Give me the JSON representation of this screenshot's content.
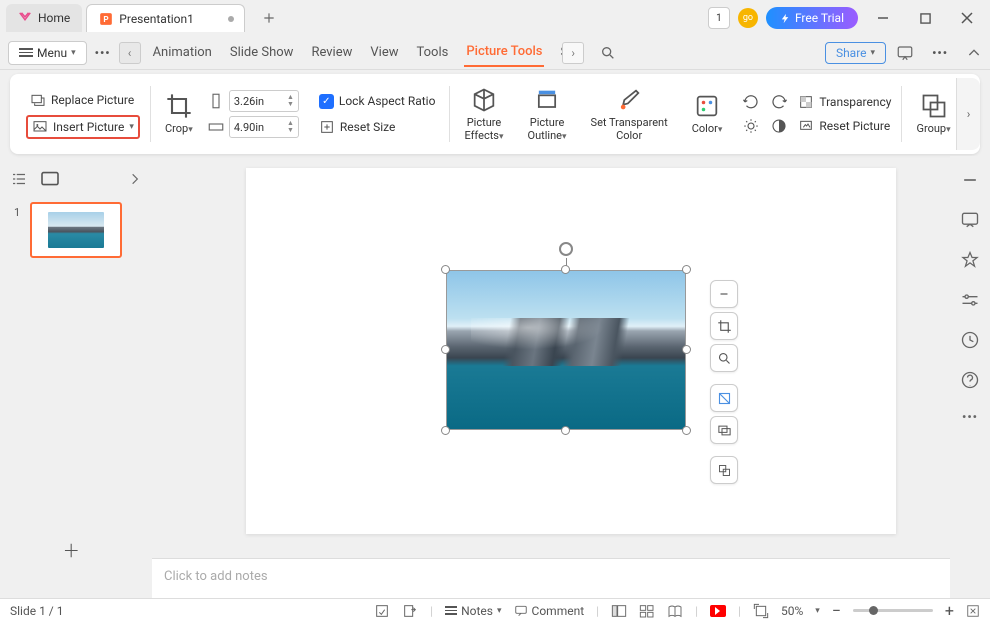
{
  "titlebar": {
    "home_label": "Home",
    "doc_name": "Presentation1",
    "free_trial": "Free Trial",
    "counter": "1",
    "avatar": "go"
  },
  "menubar": {
    "menu_label": "Menu",
    "tabs": [
      "Animation",
      "Slide Show",
      "Review",
      "View",
      "Tools"
    ],
    "active_tab": "Picture Tools",
    "overflow_tab": "S",
    "share": "Share"
  },
  "ribbon": {
    "replace_picture": "Replace Picture",
    "insert_picture": "Insert Picture",
    "crop": "Crop",
    "width": "3.26in",
    "height": "4.90in",
    "lock_aspect": "Lock Aspect Ratio",
    "reset_size": "Reset Size",
    "picture_effects": "Picture\nEffects",
    "picture_outline": "Picture\nOutline",
    "set_transparent": "Set Transparent\nColor",
    "color": "Color",
    "transparency": "Transparency",
    "reset_picture": "Reset Picture",
    "group": "Group"
  },
  "thumbs": {
    "slide1_num": "1"
  },
  "notes": {
    "placeholder": "Click to add notes"
  },
  "status": {
    "slide_info": "Slide 1 / 1",
    "notes_label": "Notes",
    "comment_label": "Comment",
    "zoom": "50%"
  }
}
